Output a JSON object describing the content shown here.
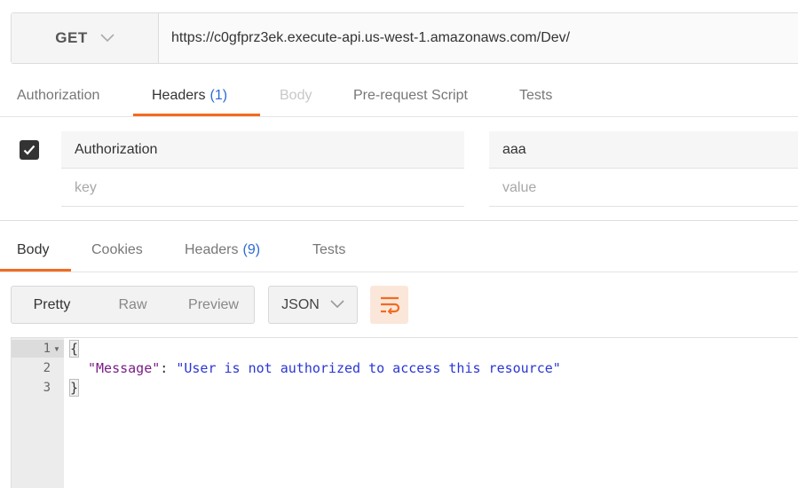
{
  "request": {
    "method": "GET",
    "url": "https://c0gfprz3ek.execute-api.us-west-1.amazonaws.com/Dev/"
  },
  "request_tabs": [
    {
      "label": "Authorization"
    },
    {
      "label": "Headers",
      "count": "(1)",
      "active": true
    },
    {
      "label": "Body",
      "disabled": true
    },
    {
      "label": "Pre-request Script"
    },
    {
      "label": "Tests"
    }
  ],
  "headers_table": {
    "rows": [
      {
        "checked": true,
        "key": "Authorization",
        "value": "aaa"
      }
    ],
    "placeholder": {
      "key": "key",
      "value": "value"
    }
  },
  "response_tabs": [
    {
      "label": "Body",
      "active": true
    },
    {
      "label": "Cookies"
    },
    {
      "label": "Headers",
      "count": "(9)"
    },
    {
      "label": "Tests"
    }
  ],
  "toolbar": {
    "view_modes": [
      "Pretty",
      "Raw",
      "Preview"
    ],
    "active_view": "Pretty",
    "format": "JSON",
    "wrap_icon": "wrap-lines-icon"
  },
  "response_body": {
    "line_numbers": [
      "1",
      "2",
      "3"
    ],
    "open_brace": "{",
    "close_brace": "}",
    "key": "\"Message\"",
    "colon": ": ",
    "value": "\"User is not authorized to access this resource\""
  },
  "colors": {
    "accent": "#f26b21",
    "count": "#2c6bd6",
    "json_key": "#7a1d86",
    "json_string": "#2a36d4"
  }
}
